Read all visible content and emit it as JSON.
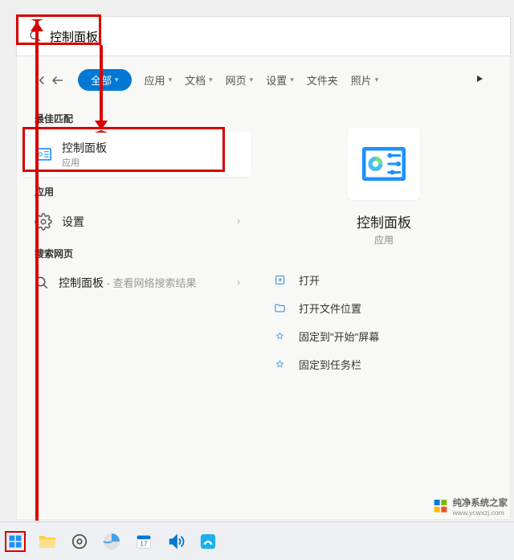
{
  "search": {
    "query": "控制面板",
    "placeholder": ""
  },
  "tabs": {
    "all": "全部",
    "apps": "应用",
    "docs": "文档",
    "web": "网页",
    "settings": "设置",
    "folders": "文件夹",
    "photos": "照片"
  },
  "left": {
    "best_match_header": "最佳匹配",
    "best_match": {
      "title": "控制面板",
      "subtitle": "应用"
    },
    "apps_header": "应用",
    "settings_item": "设置",
    "web_header": "搜索网页",
    "web_item": "控制面板",
    "web_item_suffix": " - 查看网络搜索结果"
  },
  "detail": {
    "title": "控制面板",
    "subtitle": "应用",
    "actions": {
      "open": "打开",
      "open_location": "打开文件位置",
      "pin_start": "固定到\"开始\"屏幕",
      "pin_taskbar": "固定到任务栏"
    }
  },
  "watermark": {
    "line1": "纯净系统之家",
    "line2": "www.ycwxzj.com"
  }
}
